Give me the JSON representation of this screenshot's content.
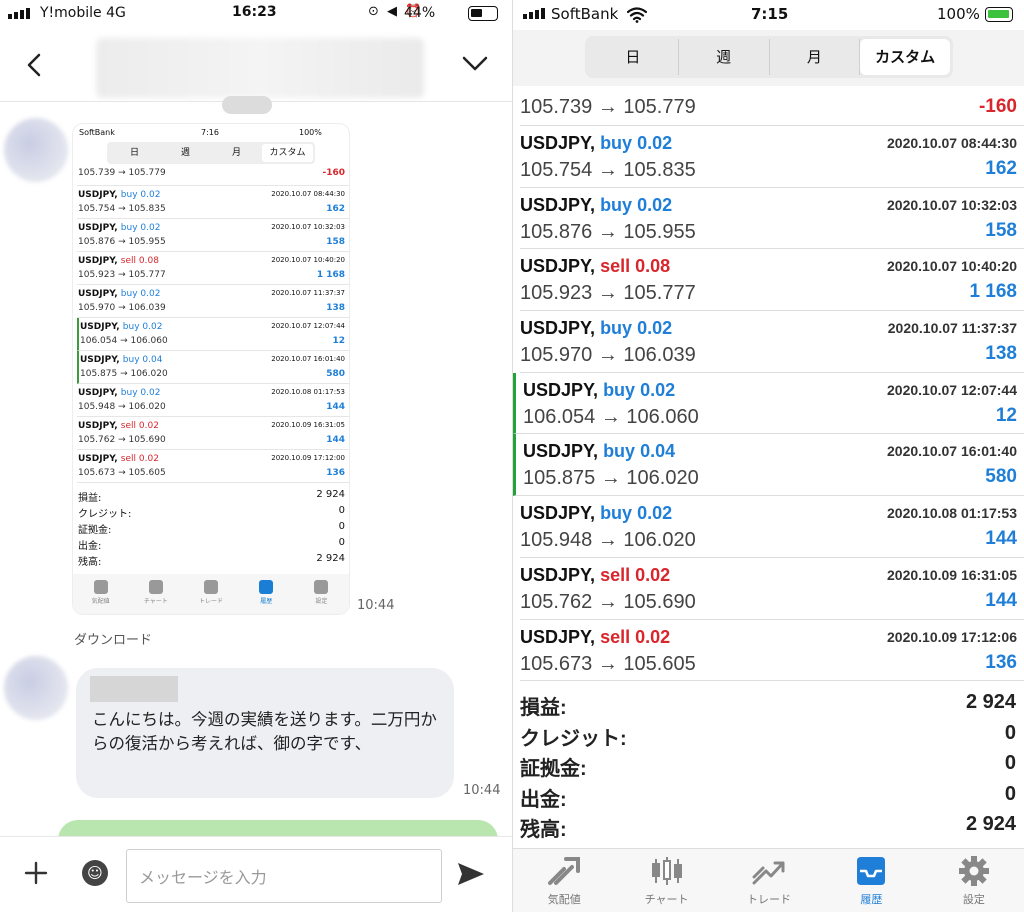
{
  "left": {
    "status": {
      "carrier": "Y!mobile  4G",
      "time": "16:23",
      "battery": "44%",
      "icons": "⊙ ◀ ⏰"
    },
    "chat": {
      "thumbnail": {
        "status": {
          "carrier": "SoftBank",
          "time": "7:16",
          "battery": "100%"
        },
        "tabs": [
          "日",
          "週",
          "月",
          "カスタム"
        ],
        "first_row": {
          "prices": "105.739 → 105.779",
          "profit": "-160"
        },
        "rows": [
          {
            "symbol": "USDJPY,",
            "side": "buy 0.02",
            "date": "2020.10.07 08:44:30",
            "prices": "105.754 → 105.835",
            "profit": "162"
          },
          {
            "symbol": "USDJPY,",
            "side": "buy 0.02",
            "date": "2020.10.07 10:32:03",
            "prices": "105.876 → 105.955",
            "profit": "158"
          },
          {
            "symbol": "USDJPY,",
            "side": "sell 0.08",
            "date": "2020.10.07 10:40:20",
            "prices": "105.923 → 105.777",
            "profit": "1 168"
          },
          {
            "symbol": "USDJPY,",
            "side": "buy 0.02",
            "date": "2020.10.07 11:37:37",
            "prices": "105.970 → 106.039",
            "profit": "138"
          },
          {
            "symbol": "USDJPY,",
            "side": "buy 0.02",
            "date": "2020.10.07 12:07:44",
            "prices": "106.054 → 106.060",
            "profit": "12"
          },
          {
            "symbol": "USDJPY,",
            "side": "buy 0.04",
            "date": "2020.10.07 16:01:40",
            "prices": "105.875 → 106.020",
            "profit": "580"
          },
          {
            "symbol": "USDJPY,",
            "side": "buy 0.02",
            "date": "2020.10.08 01:17:53",
            "prices": "105.948 → 106.020",
            "profit": "144"
          },
          {
            "symbol": "USDJPY,",
            "side": "sell 0.02",
            "date": "2020.10.09 16:31:05",
            "prices": "105.762 → 105.690",
            "profit": "144"
          },
          {
            "symbol": "USDJPY,",
            "side": "sell 0.02",
            "date": "2020.10.09 17:12:00",
            "prices": "105.673 → 105.605",
            "profit": "136"
          }
        ],
        "summary": [
          {
            "k": "損益:",
            "v": "2 924"
          },
          {
            "k": "クレジット:",
            "v": "0"
          },
          {
            "k": "証拠金:",
            "v": "0"
          },
          {
            "k": "出金:",
            "v": "0"
          },
          {
            "k": "残高:",
            "v": "2 924"
          }
        ],
        "tabbar": [
          "気配値",
          "チャート",
          "トレード",
          "履歴",
          "設定"
        ]
      },
      "image_time": "10:44",
      "download_label": "ダウンロード",
      "message_text": "こんにちは。今週の実績を送ります。二万円からの復活から考えれば、御の字です、",
      "message_time": "10:44"
    },
    "input": {
      "placeholder": "メッセージを入力"
    }
  },
  "right": {
    "status": {
      "carrier": "SoftBank",
      "time": "7:15",
      "battery": "100%"
    },
    "tabs": [
      "日",
      "週",
      "月",
      "カスタム"
    ],
    "active_tab": "カスタム",
    "first_row": {
      "prices": "105.739 → 105.779",
      "profit": "-160"
    },
    "rows": [
      {
        "symbol": "USDJPY,",
        "side": "buy 0.02",
        "date": "2020.10.07 08:44:30",
        "prices": "105.754 → 105.835",
        "profit": "162"
      },
      {
        "symbol": "USDJPY,",
        "side": "buy 0.02",
        "date": "2020.10.07 10:32:03",
        "prices": "105.876 → 105.955",
        "profit": "158"
      },
      {
        "symbol": "USDJPY,",
        "side": "sell 0.08",
        "date": "2020.10.07 10:40:20",
        "prices": "105.923 → 105.777",
        "profit": "1 168"
      },
      {
        "symbol": "USDJPY,",
        "side": "buy 0.02",
        "date": "2020.10.07 11:37:37",
        "prices": "105.970 → 106.039",
        "profit": "138"
      },
      {
        "symbol": "USDJPY,",
        "side": "buy 0.02",
        "date": "2020.10.07 12:07:44",
        "prices": "106.054 → 106.060",
        "profit": "12"
      },
      {
        "symbol": "USDJPY,",
        "side": "buy 0.04",
        "date": "2020.10.07 16:01:40",
        "prices": "105.875 → 106.020",
        "profit": "580"
      },
      {
        "symbol": "USDJPY,",
        "side": "buy 0.02",
        "date": "2020.10.08 01:17:53",
        "prices": "105.948 → 106.020",
        "profit": "144"
      },
      {
        "symbol": "USDJPY,",
        "side": "sell 0.02",
        "date": "2020.10.09 16:31:05",
        "prices": "105.762 → 105.690",
        "profit": "144"
      },
      {
        "symbol": "USDJPY,",
        "side": "sell 0.02",
        "date": "2020.10.09 17:12:06",
        "prices": "105.673 → 105.605",
        "profit": "136"
      }
    ],
    "summary": [
      {
        "k": "損益:",
        "v": "2 924"
      },
      {
        "k": "クレジット:",
        "v": "0"
      },
      {
        "k": "証拠金:",
        "v": "0"
      },
      {
        "k": "出金:",
        "v": "0"
      },
      {
        "k": "残高:",
        "v": "2 924"
      }
    ],
    "tabbar": [
      {
        "label": "気配値",
        "icon": "quotes-icon"
      },
      {
        "label": "チャート",
        "icon": "chart-icon"
      },
      {
        "label": "トレード",
        "icon": "trade-icon"
      },
      {
        "label": "履歴",
        "icon": "history-icon"
      },
      {
        "label": "設定",
        "icon": "settings-icon"
      }
    ],
    "active_tabbar": "履歴"
  },
  "colors": {
    "buy": "#1f7fd8",
    "sell": "#d8262c",
    "selected_bar": "#25a33a",
    "accent": "#1f7fd8"
  }
}
